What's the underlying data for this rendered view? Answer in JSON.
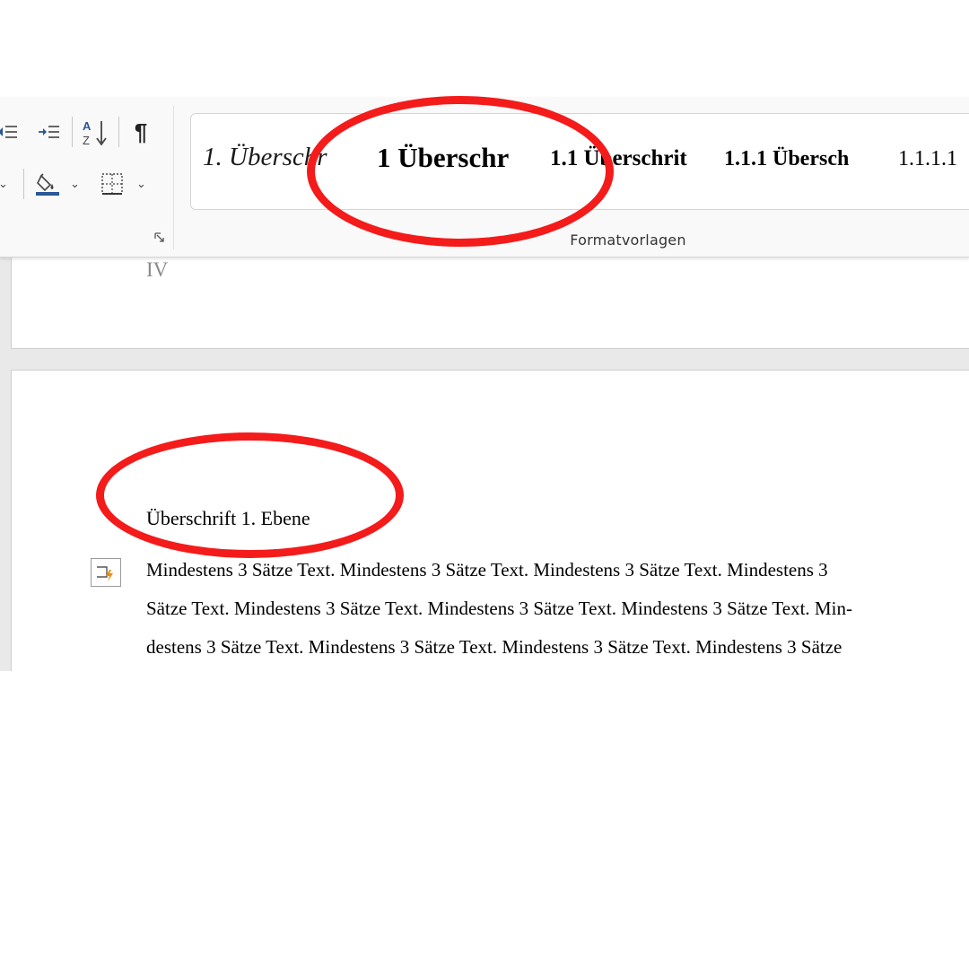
{
  "ribbon": {
    "styles_gallery": {
      "items": [
        "1. Überschr",
        "1 Überschr",
        "1.1 Überschrit",
        "1.1.1 Übersch",
        "1.1.1.1"
      ]
    },
    "group_label": "Formatvorlagen",
    "icons": {
      "decrease_indent": "decrease-indent-icon",
      "increase_indent": "increase-indent-icon",
      "sort": "sort-az-icon",
      "pilcrow_symbol": "¶",
      "shading": "shading-bucket-icon",
      "borders": "borders-icon"
    }
  },
  "document": {
    "prev_page_number": "IV",
    "heading": "Überschrift 1. Ebene",
    "paragraph_lines": [
      "Mindestens 3 Sätze Text. Mindestens 3 Sätze Text. Mindestens 3 Sätze Text. Mindestens 3",
      "Sätze Text. Mindestens 3 Sätze Text. Mindestens 3 Sätze  Text. Mindestens 3 Sätze Text. Min-",
      "destens 3 Sätze Text. Mindestens 3 Sätze Text. Mindestens 3 Sätze Text. Mindestens 3 Sätze"
    ]
  },
  "colors": {
    "annotation": "#f41b1b",
    "icon_accent": "#2b5797",
    "margin_icon_accent": "#f08a00"
  }
}
